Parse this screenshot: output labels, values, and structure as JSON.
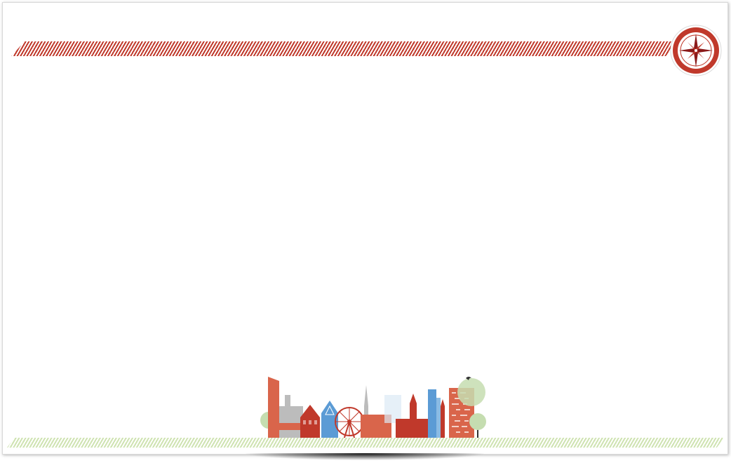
{
  "theme": {
    "red": "#c0392b",
    "dark_red": "#a01818",
    "coral": "#d9654b",
    "blue": "#5b9bd5",
    "light_green": "#cfe3b2",
    "tree_green": "#c5ddb0",
    "gray": "#bcbcbc"
  },
  "decorations": {
    "top_band": "diagonal-stripe-band",
    "badge": "compass-rose-icon",
    "footer": "city-skyline-illustration",
    "bottom_band": "diagonal-stripe-band"
  }
}
